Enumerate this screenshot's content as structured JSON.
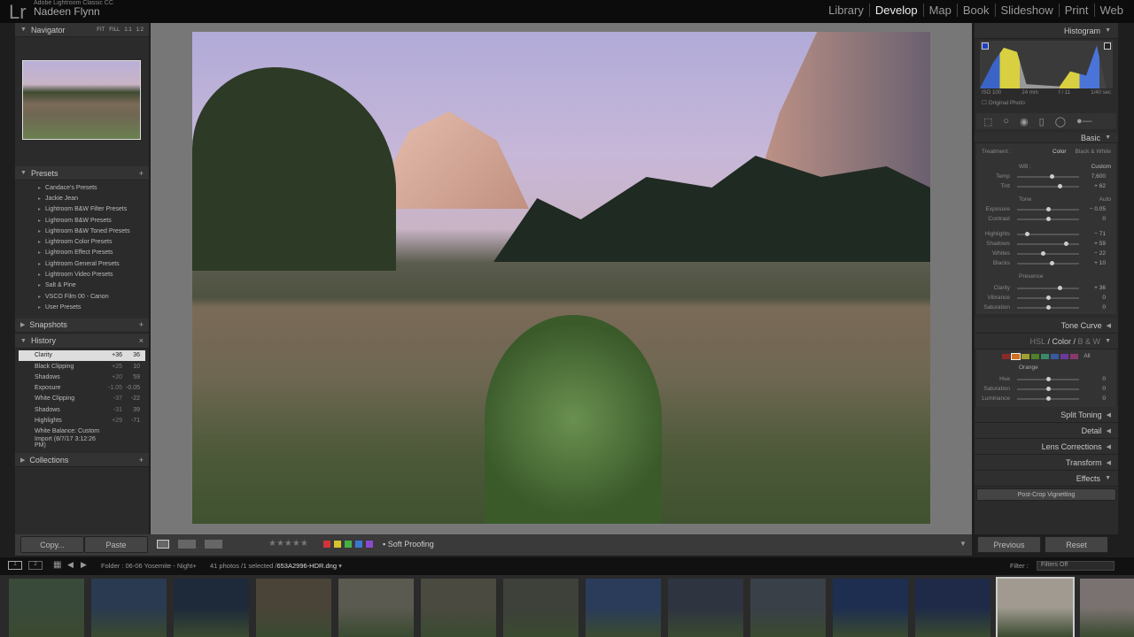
{
  "app": {
    "logo": "Lr",
    "product": "Adobe Lightroom Classic CC",
    "user": "Nadeen Flynn"
  },
  "modules": [
    {
      "label": "Library"
    },
    {
      "label": "Develop",
      "active": true
    },
    {
      "label": "Map"
    },
    {
      "label": "Book"
    },
    {
      "label": "Slideshow"
    },
    {
      "label": "Print"
    },
    {
      "label": "Web"
    }
  ],
  "left": {
    "navigator": {
      "title": "Navigator",
      "zoom": [
        "FIT",
        "FILL",
        "1:1",
        "1:2"
      ]
    },
    "presets": {
      "title": "Presets",
      "items": [
        "Candace's Presets",
        "Jackie Jean",
        "Lightroom B&W Filter Presets",
        "Lightroom B&W Presets",
        "Lightroom B&W Toned Presets",
        "Lightroom Color Presets",
        "Lightroom Effect Presets",
        "Lightroom General Presets",
        "Lightroom Video Presets",
        "Salt & Pine",
        "VSCO Film 00 - Canon",
        "User Presets"
      ]
    },
    "snapshots": {
      "title": "Snapshots"
    },
    "history": {
      "title": "History",
      "items": [
        {
          "label": "Clarity",
          "delta": "+36",
          "value": "36",
          "selected": true
        },
        {
          "label": "Black Clipping",
          "delta": "+25",
          "value": "10"
        },
        {
          "label": "Shadows",
          "delta": "+20",
          "value": "59"
        },
        {
          "label": "Exposure",
          "delta": "-1.05",
          "value": "-0.05"
        },
        {
          "label": "White Clipping",
          "delta": "-37",
          "value": "-22"
        },
        {
          "label": "Shadows",
          "delta": "-31",
          "value": "39"
        },
        {
          "label": "Highlights",
          "delta": "+29",
          "value": "-71"
        },
        {
          "label": "White Balance: Custom",
          "delta": "",
          "value": ""
        },
        {
          "label": "Import (8/7/17 3:12:26 PM)",
          "delta": "",
          "value": ""
        }
      ]
    },
    "collections": {
      "title": "Collections"
    },
    "copy": "Copy...",
    "paste": "Paste"
  },
  "right": {
    "histogram": {
      "title": "Histogram",
      "iso": "ISO 100",
      "focal": "24 mm",
      "aperture": "f / 11",
      "shutter": "1/40 sec",
      "original_photo": "Original Photo"
    },
    "basic": {
      "title": "Basic",
      "treatment_label": "Treatment :",
      "color": "Color",
      "bw": "Black & White",
      "wb_label": "WB :",
      "wb_value": "Custom",
      "wb": [
        {
          "label": "Temp",
          "value": "7,600",
          "pos": 0.56
        },
        {
          "label": "Tint",
          "value": "+ 62",
          "pos": 0.68
        }
      ],
      "tone_label": "Tone",
      "auto": "Auto",
      "tone": [
        {
          "label": "Exposure",
          "value": "− 0.05",
          "pos": 0.5
        },
        {
          "label": "Contrast",
          "value": "0",
          "pos": 0.5
        }
      ],
      "tone2": [
        {
          "label": "Highlights",
          "value": "− 71",
          "pos": 0.15
        },
        {
          "label": "Shadows",
          "value": "+ 59",
          "pos": 0.78
        },
        {
          "label": "Whites",
          "value": "− 22",
          "pos": 0.42
        },
        {
          "label": "Blacks",
          "value": "+ 10",
          "pos": 0.55
        }
      ],
      "presence_label": "Presence",
      "presence": [
        {
          "label": "Clarity",
          "value": "+ 36",
          "pos": 0.68
        },
        {
          "label": "Vibrance",
          "value": "0",
          "pos": 0.5
        },
        {
          "label": "Saturation",
          "value": "0",
          "pos": 0.5
        }
      ]
    },
    "tone_curve": "Tone Curve",
    "hsl": {
      "hsl": "HSL",
      "color": "Color",
      "bw": "B & W",
      "all": "All",
      "selected": "Orange",
      "swatches": [
        "#8a2a2a",
        "#d07020",
        "#a0a030",
        "#50802a",
        "#3a8a6a",
        "#3a5aa0",
        "#6a3a9a",
        "#8a3a6a"
      ],
      "rows": [
        {
          "label": "Hue",
          "value": "0",
          "pos": 0.5
        },
        {
          "label": "Saturation",
          "value": "0",
          "pos": 0.5
        },
        {
          "label": "Luminance",
          "value": "0",
          "pos": 0.5
        }
      ]
    },
    "sections": [
      "Split Toning",
      "Detail",
      "Lens Corrections",
      "Transform",
      "Effects"
    ],
    "post_crop": "Post-Crop Vignetting",
    "previous": "Previous",
    "reset": "Reset"
  },
  "toolbar": {
    "soft_proofing": "Soft Proofing",
    "labels": [
      "#d0343a",
      "#d6c52e",
      "#46b046",
      "#3a78d0",
      "#8a4ad0"
    ]
  },
  "filmstrip": {
    "views": [
      "1",
      "2"
    ],
    "folder": "Folder : 06-06  Yosemite - Night+",
    "count": "41 photos /1 selected /",
    "file": "653A2996-HDR.dng",
    "filter_label": "Filter :",
    "filter_value": "Filters Off",
    "thumbs": [
      "#3a4a3a",
      "#2a3a50",
      "#1e2a3a",
      "#4a4438",
      "#5a5a50",
      "#4a4a40",
      "#3e403a",
      "#2a3c5a",
      "#2e3440",
      "#3a4048",
      "#1e2e50",
      "#1e2a48",
      "#a09a90",
      "#7a7270"
    ]
  }
}
